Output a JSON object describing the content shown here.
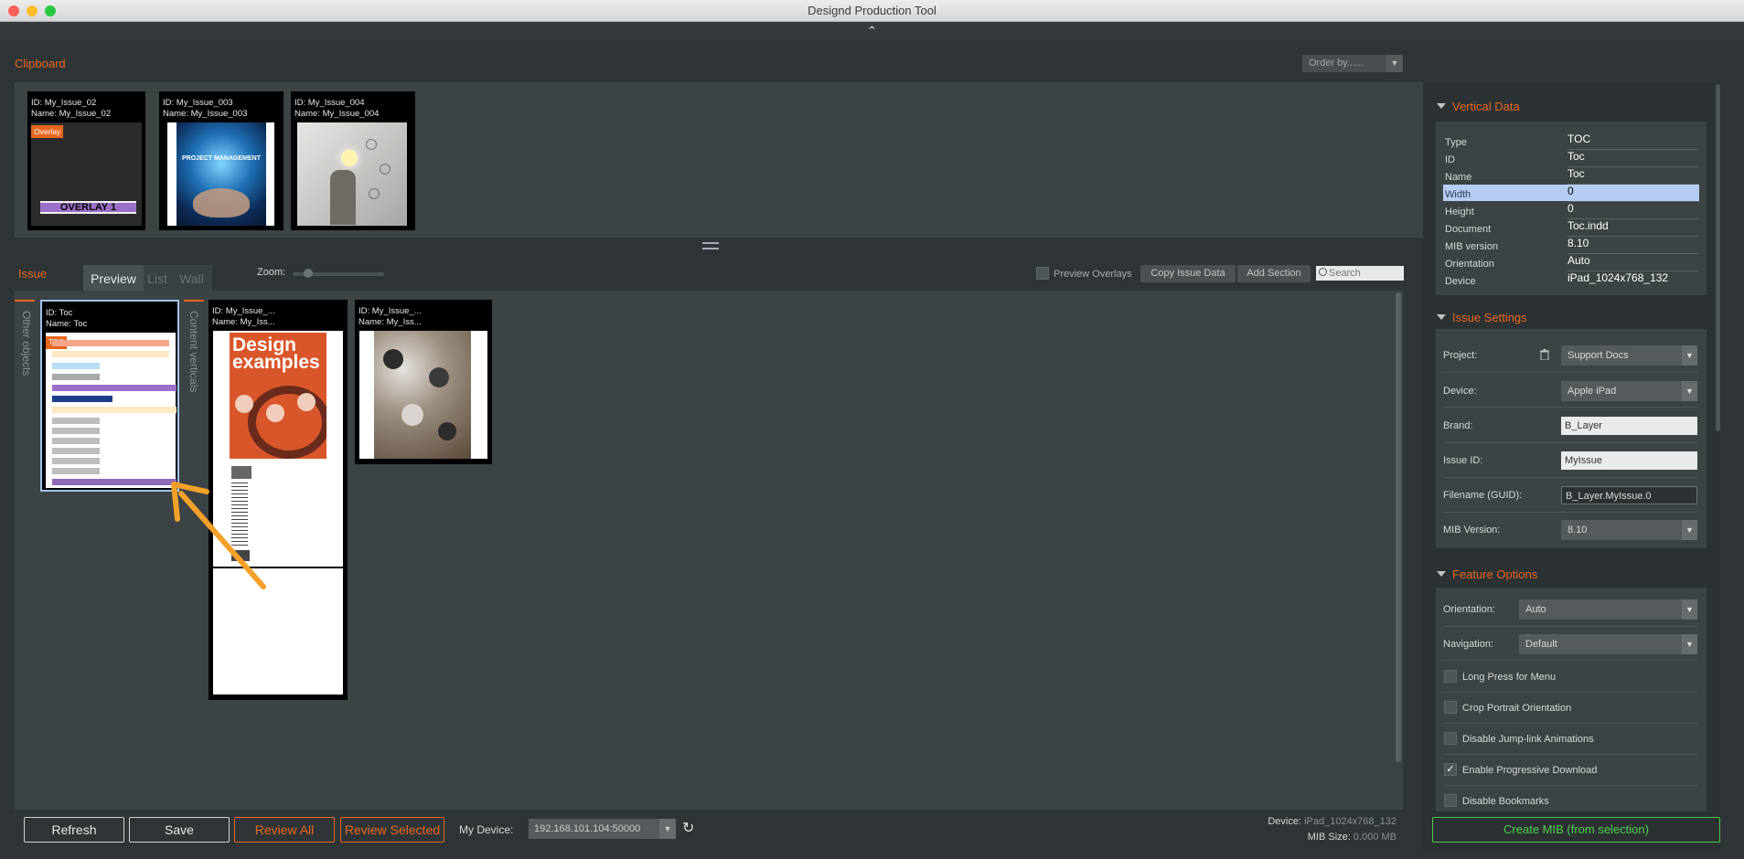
{
  "window": {
    "title": "Designd Production Tool"
  },
  "collapse_icon": "chevron-up-icon",
  "clipboard": {
    "label": "Clipboard",
    "order_by": "Order by......",
    "items": [
      {
        "id": "ID: My_Issue_02",
        "name": "Name: My_Issue_02",
        "overlay_badge": "Overlay",
        "overlay_text": "OVERLAY 1"
      },
      {
        "id": "ID: My_Issue_003",
        "name": "Name: My_Issue_003",
        "cover_text": "PROJECT MANAGEMENT"
      },
      {
        "id": "ID: My_Issue_004",
        "name": "Name: My_Issue_004"
      }
    ]
  },
  "issue": {
    "label": "Issue",
    "tabs": [
      "Preview",
      "List",
      "Wall"
    ],
    "zoom_label": "Zoom:",
    "preview_overlays": "Preview Overlays",
    "copy_issue_data": "Copy Issue Data",
    "add_section": "Add Section",
    "search_placeholder": "Search",
    "side_tabs": [
      "Other objects",
      "Content verticals"
    ],
    "items": [
      {
        "id": "ID: Toc",
        "name": "Name: Toc",
        "badge": "TOC"
      },
      {
        "id": "ID: My_Issue_...",
        "name": "Name: My_Iss...",
        "cover_title": "Design examples"
      },
      {
        "id": "ID: My_Issue_...",
        "name": "Name: My_Iss..."
      }
    ]
  },
  "bottom": {
    "refresh": "Refresh",
    "save": "Save",
    "review_all": "Review All",
    "review_selected": "Review Selected",
    "my_device_label": "My Device:",
    "my_device_value": "192.168.101.104:50000",
    "device_label": "Device:",
    "device_value": "iPad_1024x768_132",
    "mib_size_label": "MIB Size:",
    "mib_size_value": "0.000 MB"
  },
  "vertical_data": {
    "title": "Vertical Data",
    "rows": [
      {
        "k": "Type",
        "v": "TOC"
      },
      {
        "k": "ID",
        "v": "Toc"
      },
      {
        "k": "Name",
        "v": "Toc"
      },
      {
        "k": "Width",
        "v": "0"
      },
      {
        "k": "Height",
        "v": "0"
      },
      {
        "k": "Document",
        "v": "Toc.indd"
      },
      {
        "k": "MIB version",
        "v": "8.10"
      },
      {
        "k": "Orientation",
        "v": "Auto"
      },
      {
        "k": "Device",
        "v": "iPad_1024x768_132"
      }
    ]
  },
  "issue_settings": {
    "title": "Issue Settings",
    "project_label": "Project:",
    "project_value": "Support Docs",
    "device_label": "Device:",
    "device_value": "Apple iPad",
    "brand_label": "Brand:",
    "brand_value": "B_Layer",
    "issue_id_label": "Issue ID:",
    "issue_id_value": "MyIssue",
    "filename_label": "Filename (GUID):",
    "filename_value": "B_Layer.MyIssue.0",
    "mib_label": "MIB Version:",
    "mib_value": "8.10"
  },
  "feature_options": {
    "title": "Feature Options",
    "orientation_label": "Orientation:",
    "orientation_value": "Auto",
    "navigation_label": "Navigation:",
    "navigation_value": "Default",
    "checks": [
      {
        "label": "Long Press for Menu",
        "checked": false
      },
      {
        "label": "Crop Portrait Orientation",
        "checked": false
      },
      {
        "label": "Disable Jump-link Animations",
        "checked": false
      },
      {
        "label": "Enable Progressive Download",
        "checked": true
      },
      {
        "label": "Disable Bookmarks",
        "checked": false
      }
    ]
  },
  "create_mib": "Create MIB (from selection)",
  "colors": {
    "accent": "#e8661e",
    "green": "#4cd14c",
    "selection": "#b5cdf2"
  }
}
